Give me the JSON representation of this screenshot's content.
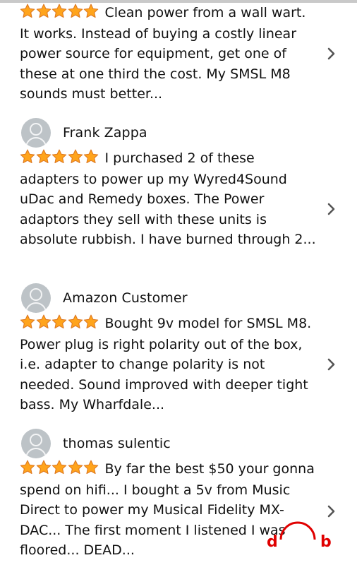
{
  "reviews": [
    {
      "name": "",
      "rating": 5,
      "text": "Clean power from a wall wart. It works. Instead of buying a costly linear power source for equipment, get one of these at one third the cost. My SMSL M8 sounds must better..."
    },
    {
      "name": "Frank Zappa",
      "rating": 5,
      "text": "I purchased 2 of these adapters to power up my Wyred4Sound uDac and Remedy boxes. The Power adaptors they sell with these units is absolute rubbish. I have burned through 2..."
    },
    {
      "name": "Amazon Customer",
      "rating": 5,
      "text": "Bought 9v model for SMSL M8. Power plug is right polarity out of the box, i.e. adapter to change polarity is not needed. Sound improved with deeper tight bass. My Wharfdale..."
    },
    {
      "name": "thomas sulentic",
      "rating": 5,
      "text": "By far the best $50 your gonna spend on hifi... I bought a 5v from Music Direct to power my Musical Fidelity MX-DAC... The first moment I listened I was floored... DEAD..."
    }
  ],
  "icons": {
    "avatar": "user-avatar-icon",
    "star": "star-icon",
    "chevron": "chevron-right-icon",
    "watermark": "headphones-logo-icon"
  },
  "colors": {
    "star_fill": "#ffa41c",
    "star_stroke": "#de7921",
    "chevron": "#555555",
    "avatar": "#bdc3c7",
    "watermark": "#e00000"
  }
}
